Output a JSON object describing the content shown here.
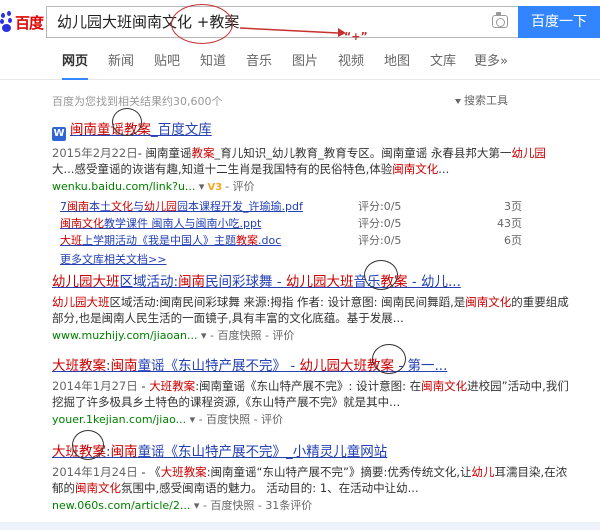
{
  "search": {
    "logo": "百度",
    "query": "幼儿园大班闽南文化 +教案",
    "button": "百度一下"
  },
  "annotation": {
    "plus_note": "“+”"
  },
  "tabs": [
    {
      "label": "网页",
      "active": true
    },
    {
      "label": "新闻"
    },
    {
      "label": "贴吧"
    },
    {
      "label": "知道"
    },
    {
      "label": "音乐"
    },
    {
      "label": "图片"
    },
    {
      "label": "视频"
    },
    {
      "label": "地图"
    },
    {
      "label": "文库"
    },
    {
      "label": "更多»"
    }
  ],
  "results_info": {
    "count_text": "百度为您找到相关结果约30,600个",
    "tools_label": "搜索工具"
  },
  "results": [
    {
      "icon": "W",
      "title_parts": [
        "闽南童谣",
        "教案",
        "_百度文库"
      ],
      "date": "2015年2月22日",
      "abstract_parts": [
        "- 闽南童谣",
        "教案",
        "_育儿知识_幼儿教育_教育专区。闽南童谣 永春县邦大第一",
        "幼儿园",
        " 大",
        "...感受童谣的诙谐有趣,知道十二生肖是我国特有的民俗特色,体验",
        "闽南文化",
        "..."
      ],
      "url": "wenku.baidu.com/link?u...",
      "v3": "V3",
      "eval": "评价",
      "sub_items": [
        {
          "title_parts": [
            "7",
            "闽南",
            "本土",
            "文化",
            "与",
            "幼儿园",
            "园本课程开发_许瑜瑜.pdf"
          ],
          "score": "评分:0/5",
          "pages": "3页"
        },
        {
          "title_parts": [
            "闽南文化",
            "教学课件 闽南人与闽南小吃.ppt"
          ],
          "score": "评分:0/5",
          "pages": "43页"
        },
        {
          "title_parts": [
            "大班",
            "上学期活动《我是中国人》主题",
            "教案",
            ".doc"
          ],
          "score": "评分:0/5",
          "pages": "6页"
        }
      ],
      "more": "更多文库相关文档>>"
    },
    {
      "title_parts": [
        "幼儿园大班",
        "区域活动:",
        "闽南",
        "民间彩球舞 - ",
        "幼儿园大班",
        "音乐",
        "教案",
        " - 幼儿..."
      ],
      "abstract_parts": [
        "幼儿园大班",
        "区域活动:闽南民间彩球舞 来源:拇指 作者: 设计意图: 闽南民间舞蹈,是",
        "闽南文化",
        "的重要组成部分,也是闽南人民生活的一面镜子,具有丰富的文化底蕴。基于发展..."
      ],
      "url": "www.muzhijy.com/jiaoan...",
      "snapshot": "百度快照",
      "eval": "评价"
    },
    {
      "title_parts": [
        "大班",
        "教案",
        ":",
        "闽南",
        "童谣《东山特产展不完》 - ",
        "幼儿园大班",
        "教案",
        " - 第一..."
      ],
      "date": "2014年1月27日",
      "abstract_parts": [
        " - ",
        "大班",
        "教案",
        ":闽南童谣《东山特产展不完》: 设计意图: 在",
        "闽南文化",
        "进校园”活动中,我们挖掘了许多极具乡土特色的课程资源,《东山特产展不完》就是其中..."
      ],
      "url": "youer.1kejian.com/jiao...",
      "snapshot": "百度快照",
      "eval": "评价"
    },
    {
      "title_parts": [
        "大班",
        "教案",
        ":",
        "闽南",
        "童谣《东山特产展不完》_小精灵儿童网站"
      ],
      "date": "2014年1月24日",
      "abstract_parts": [
        " - 《",
        "大班",
        "教案",
        ":闽南童谣“东山特产展不完”》摘要:优秀传统文化,让",
        "幼儿",
        "耳濡目染,在浓郁的",
        "闽南文化",
        "氛围中,感受闽南语的魅力。 活动目的: 1、在活动中让幼..."
      ],
      "url": "new.060s.com/article/2...",
      "snapshot": "百度快照",
      "eval": "31条评价"
    }
  ]
}
